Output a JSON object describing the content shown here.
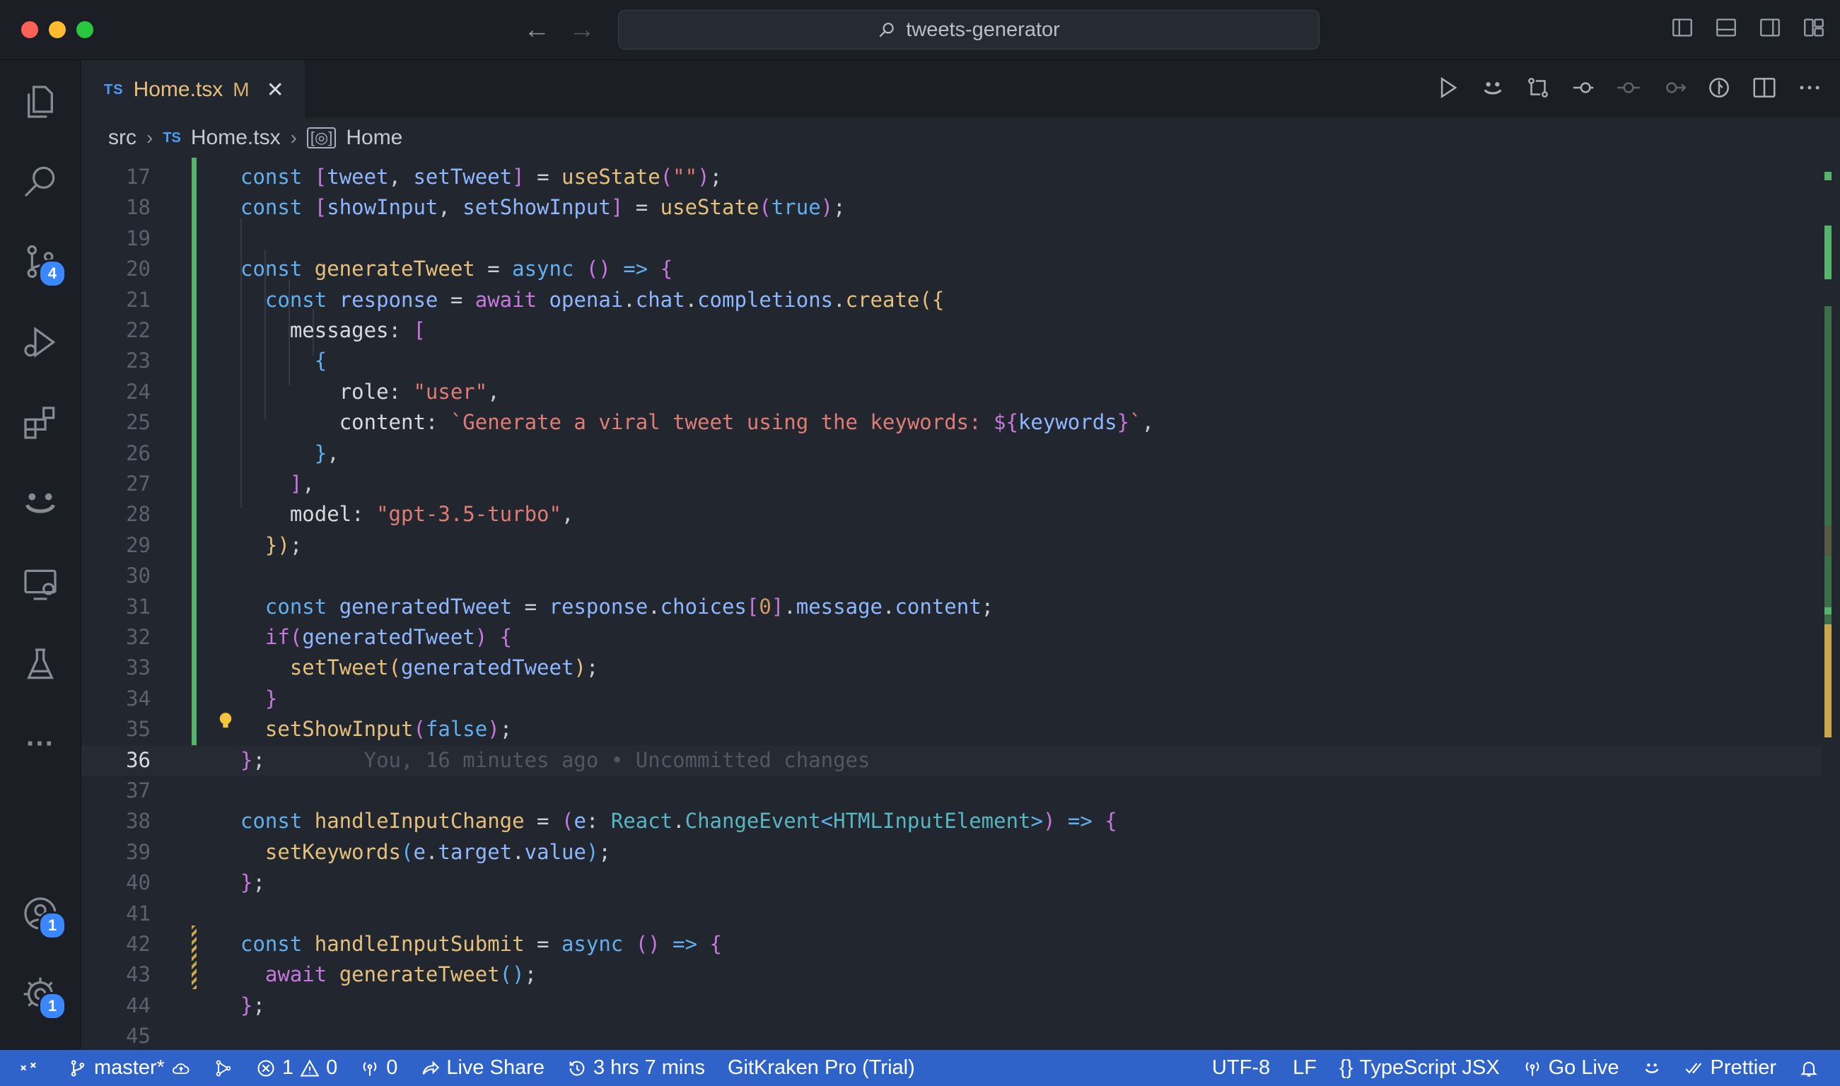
{
  "window": {
    "search_text": "tweets-generator"
  },
  "tab": {
    "lang_badge": "TS",
    "title": "Home.tsx",
    "status": "M",
    "close": "✕"
  },
  "breadcrumb": {
    "folder": "src",
    "lang_badge": "TS",
    "file": "Home.tsx",
    "symbol_icon": "[◎]",
    "symbol": "Home"
  },
  "activity": {
    "source_control_badge": "4",
    "accounts_badge": "1",
    "settings_badge": "1",
    "more": "···"
  },
  "editor": {
    "current_line": "36",
    "blame": "You, 16 minutes ago • Uncommitted changes",
    "lines": [
      {
        "n": "17",
        "tokens": [
          [
            "kb",
            "const "
          ],
          [
            "b2",
            "["
          ],
          [
            "pr",
            "tweet"
          ],
          [
            "pu",
            ", "
          ],
          [
            "pr",
            "setTweet"
          ],
          [
            "b2",
            "]"
          ],
          [
            "pu",
            " = "
          ],
          [
            "fn",
            "useState"
          ],
          [
            "b2",
            "("
          ],
          [
            "st",
            "\"\""
          ],
          [
            "b2",
            ")"
          ],
          [
            "pu",
            ";"
          ]
        ]
      },
      {
        "n": "18",
        "tokens": [
          [
            "kb",
            "const "
          ],
          [
            "b2",
            "["
          ],
          [
            "pr",
            "showInput"
          ],
          [
            "pu",
            ", "
          ],
          [
            "pr",
            "setShowInput"
          ],
          [
            "b2",
            "]"
          ],
          [
            "pu",
            " = "
          ],
          [
            "fn",
            "useState"
          ],
          [
            "b2",
            "("
          ],
          [
            "kb",
            "true"
          ],
          [
            "b2",
            ")"
          ],
          [
            "pu",
            ";"
          ]
        ]
      },
      {
        "n": "19",
        "tokens": []
      },
      {
        "n": "20",
        "tokens": [
          [
            "kb",
            "const "
          ],
          [
            "fn",
            "generateTweet"
          ],
          [
            "pu",
            " = "
          ],
          [
            "kb",
            "async "
          ],
          [
            "b2",
            "() "
          ],
          [
            "kb",
            "=> "
          ],
          [
            "b2",
            "{"
          ]
        ]
      },
      {
        "n": "21",
        "tokens": [
          [
            "pu",
            "  "
          ],
          [
            "kb",
            "const "
          ],
          [
            "pr",
            "response"
          ],
          [
            "pu",
            " = "
          ],
          [
            "kw",
            "await "
          ],
          [
            "pr",
            "openai"
          ],
          [
            "pu",
            "."
          ],
          [
            "pr",
            "chat"
          ],
          [
            "pu",
            "."
          ],
          [
            "pr",
            "completions"
          ],
          [
            "pu",
            "."
          ],
          [
            "fn",
            "create"
          ],
          [
            "b1",
            "({"
          ]
        ]
      },
      {
        "n": "22",
        "tokens": [
          [
            "pu",
            "    "
          ],
          [
            "vr",
            "messages"
          ],
          [
            "pu",
            ": "
          ],
          [
            "b2",
            "["
          ]
        ]
      },
      {
        "n": "23",
        "tokens": [
          [
            "pu",
            "      "
          ],
          [
            "b3",
            "{"
          ]
        ]
      },
      {
        "n": "24",
        "tokens": [
          [
            "pu",
            "        "
          ],
          [
            "vr",
            "role"
          ],
          [
            "pu",
            ": "
          ],
          [
            "st",
            "\"user\""
          ],
          [
            "pu",
            ","
          ]
        ]
      },
      {
        "n": "25",
        "tokens": [
          [
            "pu",
            "        "
          ],
          [
            "vr",
            "content"
          ],
          [
            "pu",
            ": "
          ],
          [
            "st",
            "`Generate a viral tweet using the keywords: "
          ],
          [
            "kw",
            "${"
          ],
          [
            "pr",
            "keywords"
          ],
          [
            "kw",
            "}"
          ],
          [
            "st",
            "`"
          ],
          [
            "pu",
            ","
          ]
        ]
      },
      {
        "n": "26",
        "tokens": [
          [
            "pu",
            "      "
          ],
          [
            "b3",
            "}"
          ],
          [
            "pu",
            ","
          ]
        ]
      },
      {
        "n": "27",
        "tokens": [
          [
            "pu",
            "    "
          ],
          [
            "b2",
            "]"
          ],
          [
            "pu",
            ","
          ]
        ]
      },
      {
        "n": "28",
        "tokens": [
          [
            "pu",
            "    "
          ],
          [
            "vr",
            "model"
          ],
          [
            "pu",
            ": "
          ],
          [
            "st",
            "\"gpt-3.5-turbo\""
          ],
          [
            "pu",
            ","
          ]
        ]
      },
      {
        "n": "29",
        "tokens": [
          [
            "pu",
            "  "
          ],
          [
            "b1",
            "})"
          ],
          [
            "pu",
            ";"
          ]
        ]
      },
      {
        "n": "30",
        "tokens": []
      },
      {
        "n": "31",
        "tokens": [
          [
            "pu",
            "  "
          ],
          [
            "kb",
            "const "
          ],
          [
            "pr",
            "generatedTweet"
          ],
          [
            "pu",
            " = "
          ],
          [
            "pr",
            "response"
          ],
          [
            "pu",
            "."
          ],
          [
            "pr",
            "choices"
          ],
          [
            "b2",
            "["
          ],
          [
            "nu",
            "0"
          ],
          [
            "b2",
            "]"
          ],
          [
            "pu",
            "."
          ],
          [
            "pr",
            "message"
          ],
          [
            "pu",
            "."
          ],
          [
            "pr",
            "content"
          ],
          [
            "pu",
            ";"
          ]
        ]
      },
      {
        "n": "32",
        "tokens": [
          [
            "pu",
            "  "
          ],
          [
            "kw",
            "if"
          ],
          [
            "b2",
            "("
          ],
          [
            "pr",
            "generatedTweet"
          ],
          [
            "b2",
            ") "
          ],
          [
            "b2",
            "{"
          ]
        ]
      },
      {
        "n": "33",
        "tokens": [
          [
            "pu",
            "    "
          ],
          [
            "fn",
            "setTweet"
          ],
          [
            "b1",
            "("
          ],
          [
            "pr",
            "generatedTweet"
          ],
          [
            "b1",
            ")"
          ],
          [
            "pu",
            ";"
          ]
        ]
      },
      {
        "n": "34",
        "tokens": [
          [
            "pu",
            "  "
          ],
          [
            "b2",
            "}"
          ]
        ]
      },
      {
        "n": "35",
        "tokens": [
          [
            "pu",
            "  "
          ],
          [
            "fn",
            "setShowInput"
          ],
          [
            "b2",
            "("
          ],
          [
            "kb",
            "false"
          ],
          [
            "b2",
            ")"
          ],
          [
            "pu",
            ";"
          ]
        ]
      },
      {
        "n": "36",
        "tokens": [
          [
            "b2",
            "}"
          ],
          [
            "pu",
            ";"
          ]
        ]
      },
      {
        "n": "37",
        "tokens": []
      },
      {
        "n": "38",
        "tokens": [
          [
            "kb",
            "const "
          ],
          [
            "fn",
            "handleInputChange"
          ],
          [
            "pu",
            " = "
          ],
          [
            "b2",
            "("
          ],
          [
            "pr",
            "e"
          ],
          [
            "pu",
            ": "
          ],
          [
            "ty",
            "React"
          ],
          [
            "pu",
            "."
          ],
          [
            "ty",
            "ChangeEvent"
          ],
          [
            "kb",
            "<"
          ],
          [
            "ty",
            "HTMLInputElement"
          ],
          [
            "kb",
            ">"
          ],
          [
            "b2",
            ") "
          ],
          [
            "kb",
            "=> "
          ],
          [
            "b2",
            "{"
          ]
        ]
      },
      {
        "n": "39",
        "tokens": [
          [
            "pu",
            "  "
          ],
          [
            "fn",
            "setKeywords"
          ],
          [
            "b3",
            "("
          ],
          [
            "pr",
            "e"
          ],
          [
            "pu",
            "."
          ],
          [
            "pr",
            "target"
          ],
          [
            "pu",
            "."
          ],
          [
            "pr",
            "value"
          ],
          [
            "b3",
            ")"
          ],
          [
            "pu",
            ";"
          ]
        ]
      },
      {
        "n": "40",
        "tokens": [
          [
            "b2",
            "}"
          ],
          [
            "pu",
            ";"
          ]
        ]
      },
      {
        "n": "41",
        "tokens": []
      },
      {
        "n": "42",
        "tokens": [
          [
            "kb",
            "const "
          ],
          [
            "fn",
            "handleInputSubmit"
          ],
          [
            "pu",
            " = "
          ],
          [
            "kb",
            "async "
          ],
          [
            "b2",
            "() "
          ],
          [
            "kb",
            "=> "
          ],
          [
            "b2",
            "{"
          ]
        ]
      },
      {
        "n": "43",
        "tokens": [
          [
            "pu",
            "  "
          ],
          [
            "kw",
            "await "
          ],
          [
            "fn",
            "generateTweet"
          ],
          [
            "b3",
            "()"
          ],
          [
            "pu",
            ";"
          ]
        ]
      },
      {
        "n": "44",
        "tokens": [
          [
            "b2",
            "}"
          ],
          [
            "pu",
            ";"
          ]
        ]
      },
      {
        "n": "45",
        "tokens": []
      }
    ]
  },
  "statusbar": {
    "branch": "master*",
    "errors": "1",
    "warnings": "0",
    "ports": "0",
    "live_share": "Live Share",
    "time": "3 hrs 7 mins",
    "gitkraken": "GitKraken Pro (Trial)",
    "encoding": "UTF-8",
    "eol": "LF",
    "lang_icon": "{}",
    "language": "TypeScript JSX",
    "go_live": "Go Live",
    "prettier": "Prettier"
  },
  "colors": {
    "accent": "#2f63c9",
    "editor_bg": "#22262e",
    "added": "#56b36b",
    "modified": "#caa74a",
    "badge": "#3a87ff"
  }
}
